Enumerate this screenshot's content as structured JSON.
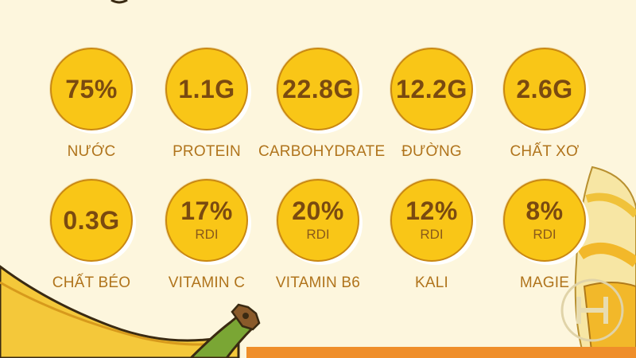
{
  "nutrients": [
    {
      "value": "75%",
      "unit": "",
      "label": "NƯỚC"
    },
    {
      "value": "1.1G",
      "unit": "",
      "label": "PROTEIN"
    },
    {
      "value": "22.8G",
      "unit": "",
      "label": "CARBOHYDRATE"
    },
    {
      "value": "12.2G",
      "unit": "",
      "label": "ĐƯỜNG"
    },
    {
      "value": "2.6G",
      "unit": "",
      "label": "CHẤT XƠ"
    },
    {
      "value": "0.3G",
      "unit": "",
      "label": "CHẤT BÉO"
    },
    {
      "value": "17%",
      "unit": "RDI",
      "label": "VITAMIN C"
    },
    {
      "value": "20%",
      "unit": "RDI",
      "label": "VITAMIN B6"
    },
    {
      "value": "12%",
      "unit": "RDI",
      "label": "KALI"
    },
    {
      "value": "8%",
      "unit": "RDI",
      "label": "MAGIE"
    }
  ],
  "colors": {
    "background": "#fdf6dd",
    "circle_fill": "#f9c617",
    "circle_border": "#c98813",
    "value_text": "#7a4a10",
    "label_text": "#b0741c",
    "accent_band": "#ef8e2a"
  },
  "icons": [
    "banana-peel-illustration",
    "banana-stem-illustration",
    "logo-watermark"
  ]
}
